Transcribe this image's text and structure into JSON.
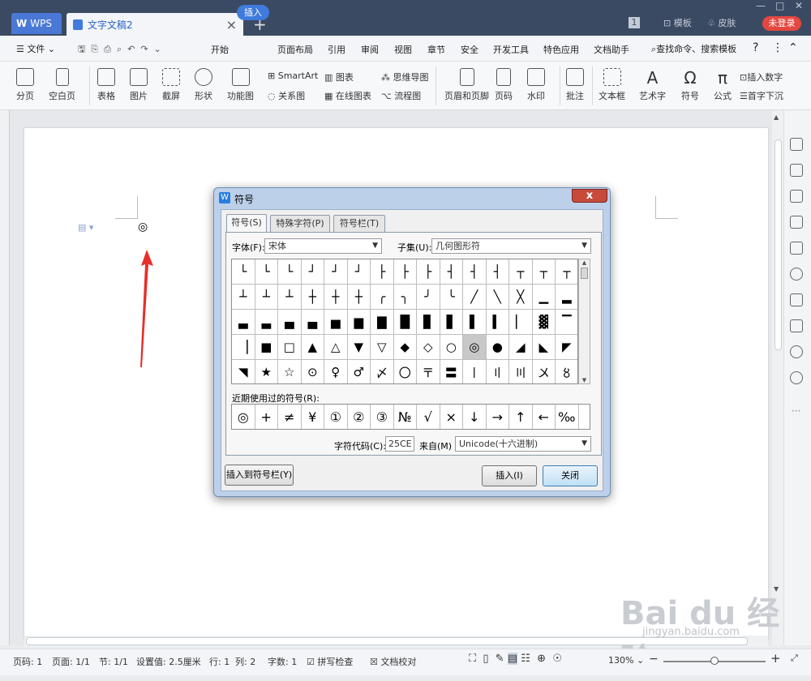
{
  "titlebar": {
    "app_tab": "WPS",
    "doc_tab": "文字文稿2",
    "badge": "1",
    "template": "模板",
    "skin": "皮肤",
    "login": "未登录"
  },
  "menubar": {
    "file": "文件",
    "items": [
      "开始",
      "插入",
      "页面布局",
      "引用",
      "审阅",
      "视图",
      "章节",
      "安全",
      "开发工具",
      "特色应用",
      "文档助手"
    ],
    "active": "插入",
    "search": "查找命令、搜索模板",
    "help": "?"
  },
  "ribbon": {
    "fenye": "分页",
    "kongbaiye": "空白页",
    "biaoge": "表格",
    "tupian": "图片",
    "jieping": "截屏",
    "xingzhuang": "形状",
    "gongneng": "功能图",
    "smartart": "SmartArt",
    "tubiao": "图表",
    "guanxitu": "关系图",
    "zaixian": "在线图表",
    "siwei": "思维导图",
    "liucheng": "流程图",
    "yemei": "页眉和页脚",
    "yema": "页码",
    "shuiyin": "水印",
    "pizhu": "批注",
    "wenbenkuang": "文本框",
    "yishuzi": "艺术字",
    "fuhao": "符号",
    "gongshi": "公式",
    "charushuzi": "插入数字",
    "shouzixiachen": "首字下沉"
  },
  "document": {
    "inserted_symbol": "◎"
  },
  "dialog": {
    "title": "符号",
    "close": "x",
    "tabs": [
      "符号(S)",
      "特殊字符(P)",
      "符号栏(T)"
    ],
    "font_label": "字体(F):",
    "font_value": "宋体",
    "subset_label": "子集(U):",
    "subset_value": "几何图形符",
    "grid": [
      [
        "└",
        "└",
        "└",
        "┘",
        "┘",
        "┘",
        "├",
        "├",
        "├",
        "┤",
        "┤",
        "┤",
        "┬",
        "┬",
        "┬"
      ],
      [
        "┴",
        "┴",
        "┴",
        "┼",
        "┼",
        "┼",
        "╭",
        "╮",
        "╯",
        "╰",
        "╱",
        "╲",
        "╳",
        "▁",
        "▂"
      ],
      [
        "▃",
        "▃",
        "▄",
        "▄",
        "▅",
        "▆",
        "▇",
        "█",
        "▊",
        "▋",
        "▌",
        "▍",
        "▏",
        "▓",
        "▔"
      ],
      [
        "▕",
        "■",
        "□",
        "▲",
        "△",
        "▼",
        "▽",
        "◆",
        "◇",
        "○",
        "◎",
        "●",
        "◢",
        "◣",
        "◤"
      ],
      [
        "◥",
        "★",
        "☆",
        "⊙",
        "♀",
        "♂",
        "〆",
        "〇",
        "〒",
        "〓",
        "〡",
        "〢",
        "〣",
        "〤",
        "〥"
      ]
    ],
    "selected_symbol": "◎",
    "recent_label": "近期使用过的符号(R):",
    "recent": [
      "◎",
      "+",
      "≠",
      "¥",
      "①",
      "②",
      "③",
      "№",
      "√",
      "×",
      "↓",
      "→",
      "↑",
      "←",
      "‰"
    ],
    "code_label": "字符代码(C):",
    "code_value": "25CE",
    "from_label": "来自(M)",
    "from_value": "Unicode(十六进制)",
    "insert_to_bar": "插入到符号栏(Y)",
    "insert": "插入(I)",
    "close_btn": "关闭"
  },
  "statusbar": {
    "page_no": "页码: 1",
    "pages": "页面: 1/1",
    "section": "节: 1/1",
    "setting": "设置值: 2.5厘米",
    "row": "行: 1",
    "col": "列: 2",
    "words": "字数: 1",
    "spell": "拼写检查",
    "proof": "文档校对",
    "zoom": "130%"
  },
  "watermark": {
    "main": "Bai du 经验",
    "sub": "jingyan.baidu.com"
  }
}
